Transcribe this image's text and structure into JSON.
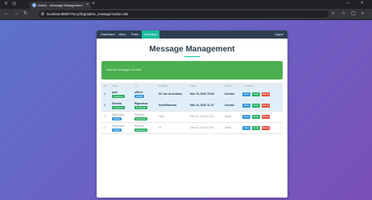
{
  "browser": {
    "tab_title": "Admin - Message Management",
    "url": "localhost:8080/?/recycling/admin_message?action=list"
  },
  "nav": {
    "links": [
      "Dashboard",
      "Users",
      "Posts",
      "Messages"
    ],
    "logout": "Logout"
  },
  "page": {
    "title": "Message Management",
    "alert_text": "Mark all messages as read"
  },
  "table": {
    "columns": [
      "ID",
      "From",
      "To",
      "Subject",
      "Date",
      "Status",
      "Actions"
    ],
    "rows": [
      {
        "id": "4",
        "from": "john",
        "from_role": "Customer",
        "to": "officer",
        "to_role": "Admin",
        "subject": "Hi I am at location",
        "date": "Mar 15, 2026 10:30",
        "status": "Unread",
        "unread": true
      },
      {
        "id": "3",
        "from": "Sheetal",
        "from_role": "Customer",
        "to": "Rajendran",
        "to_role": "Customer",
        "subject": "hmmReached",
        "date": "Mar 15, 2026 11:37",
        "status": "Unread",
        "unread": true
      },
      {
        "id": "2",
        "from": "Rajendran",
        "from_role": "Admin",
        "to": "Sheetal",
        "to_role": "Customer",
        "subject": "Hmk",
        "date": "Mar 15, 2026 13:04",
        "status": "Read",
        "unread": false
      },
      {
        "id": "1",
        "from": "Rajendran",
        "from_role": "Admin",
        "to": "Sheetal",
        "to_role": "Customer",
        "subject": "Hi",
        "date": "Mar 15, 2026 13:04",
        "status": "Read",
        "unread": false
      }
    ],
    "actions": {
      "view": "View",
      "reply": "Reply",
      "delete": "Delete"
    }
  }
}
